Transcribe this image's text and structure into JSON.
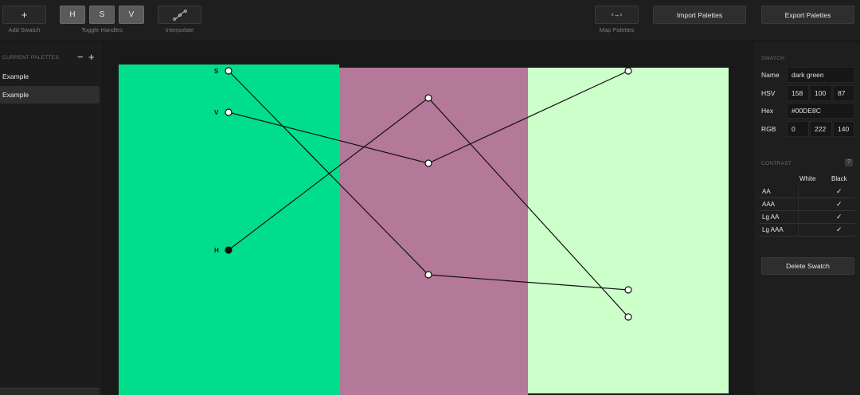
{
  "toolbar": {
    "add_swatch_icon": "+",
    "add_swatch_label": "Add Swatch",
    "toggle_h": "H",
    "toggle_s": "S",
    "toggle_v": "V",
    "toggle_handles_label": "Toggle Handles",
    "interpolate_icon": "interpolate-curve-icon",
    "interpolate_label": "Interpolate",
    "map_icon": "▫→▫",
    "map_label": "Map Palettes",
    "import_label": "Import Palettes",
    "export_label": "Export Palettes"
  },
  "sidebar": {
    "title": "Current Palettes",
    "minus": "−",
    "plus": "+",
    "palettes": [
      "Example",
      "Example"
    ],
    "selected_index": 1
  },
  "canvas": {
    "swatches": [
      {
        "name": "dark green",
        "color": "#00DE8C"
      },
      {
        "name": "",
        "color": "#B47898"
      },
      {
        "name": "",
        "color": "#CCFFCA"
      }
    ],
    "handle_labels": {
      "s": "S",
      "v": "V",
      "h": "H"
    }
  },
  "swatch_panel": {
    "title": "Swatch",
    "name_label": "Name",
    "name_value": "dark green",
    "hsv_label": "HSV",
    "hsv": [
      "158",
      "100",
      "87"
    ],
    "hex_label": "Hex",
    "hex_value": "#00DE8C",
    "rgb_label": "RGB",
    "rgb": [
      "0",
      "222",
      "140"
    ]
  },
  "contrast_panel": {
    "title": "Contrast",
    "help": "?",
    "col_white": "White",
    "col_black": "Black",
    "rows": [
      {
        "label": "AA",
        "white": "",
        "black": "✓"
      },
      {
        "label": "AAA",
        "white": "",
        "black": "✓"
      },
      {
        "label": "Lg AA",
        "white": "",
        "black": "✓"
      },
      {
        "label": "Lg AAA",
        "white": "",
        "black": "✓"
      }
    ]
  },
  "delete_label": "Delete Swatch"
}
